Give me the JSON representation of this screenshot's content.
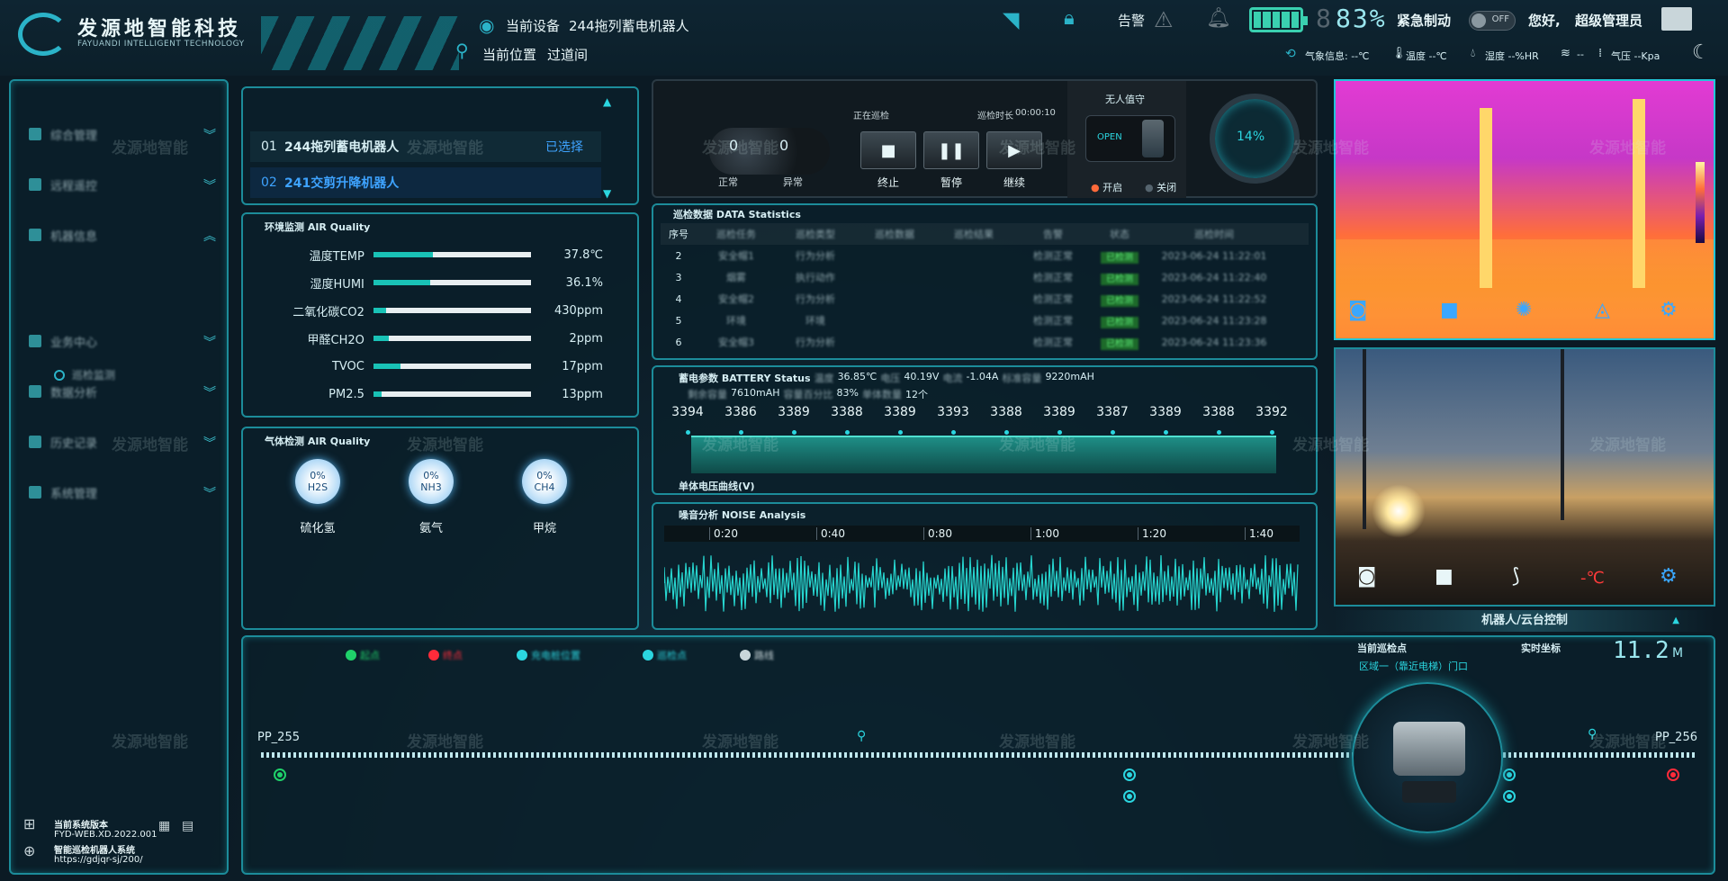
{
  "header": {
    "logo_cn": "发源地智能科技",
    "logo_en": "FAYUANDI INTELLIGENT TECHNOLOGY",
    "device_label": "当前设备",
    "device_value": "244拖列蓄电机器人",
    "location_label": "当前位置",
    "location_value": "过道间",
    "alarm_label": "告警",
    "battery_percent": "83%",
    "battery_digit": "8",
    "estop_label": "紧急制动",
    "toggle_state": "OFF",
    "greeting": "您好,",
    "user": "超级管理员",
    "weather": {
      "info": "气象信息: --℃",
      "temp": "温度 --℃",
      "humidity": "湿度 --%HR",
      "wind": "--",
      "pressure": "气压 --Kpa"
    }
  },
  "sidebar": {
    "items": [
      {
        "label": "综合管理"
      },
      {
        "label": "远程遥控"
      },
      {
        "label": "机器信息"
      },
      {
        "label": "业务中心"
      },
      {
        "label": "数据分析"
      },
      {
        "label": "历史记录"
      },
      {
        "label": "系统管理"
      }
    ],
    "sub_item": "巡检监测",
    "version_title": "当前系统版本",
    "version": "FYD-WEB.XD.2022.001",
    "system_name": "智能巡检机器人系统",
    "url": "https://gdjqr-sj/200/"
  },
  "robots": [
    {
      "no": "01",
      "name": "244拖列蓄电机器人",
      "status": "已选择"
    },
    {
      "no": "02",
      "name": "241交剪升降机器人",
      "status": ""
    }
  ],
  "env": {
    "title": "环境监测 AIR Quality",
    "rows": [
      {
        "label": "温度TEMP",
        "value": "37.8℃",
        "pct": 0.38
      },
      {
        "label": "湿度HUMI",
        "value": "36.1%",
        "pct": 0.36
      },
      {
        "label": "二氧化碳CO2",
        "value": "430ppm",
        "pct": 0.08
      },
      {
        "label": "甲醛CH2O",
        "value": "2ppm",
        "pct": 0.1
      },
      {
        "label": "TVOC",
        "value": "17ppm",
        "pct": 0.17
      },
      {
        "label": "PM2.5",
        "value": "13ppm",
        "pct": 0.05
      }
    ]
  },
  "gas": {
    "title": "气体检测 AIR Quality",
    "items": [
      {
        "pct": "0%",
        "formula": "H2S",
        "name": "硫化氢"
      },
      {
        "pct": "0%",
        "formula": "NH3",
        "name": "氨气"
      },
      {
        "pct": "0%",
        "formula": "CH4",
        "name": "甲烷"
      }
    ]
  },
  "control": {
    "normal_count": "0",
    "abnormal_count": "0",
    "normal_label": "正常",
    "abnormal_label": "异常",
    "patrolling": "正在巡检",
    "duration_label": "巡检时长",
    "duration": "00:00:10",
    "stop": "终止",
    "pause": "暂停",
    "resume": "继续",
    "unattended": "无人值守",
    "open_label": "OPEN",
    "on": "开启",
    "off": "关闭",
    "progress": "14%"
  },
  "stats": {
    "title": "巡检数据 DATA Statistics",
    "headers": [
      "序号",
      "巡检任务",
      "巡检类型",
      "巡检数据",
      "巡检结果",
      "告警",
      "状态",
      "巡检时间"
    ],
    "rows": [
      {
        "no": "2",
        "c1": "安全帽1",
        "c2": "行为分析",
        "c5": "检测正常",
        "c6": "已检测",
        "time": "2023-06-24 11:22:01"
      },
      {
        "no": "3",
        "c1": "烟雾",
        "c2": "执行动作",
        "c5": "检测正常",
        "c6": "已检测",
        "time": "2023-06-24 11:22:40"
      },
      {
        "no": "4",
        "c1": "安全帽2",
        "c2": "行为分析",
        "c5": "检测正常",
        "c6": "已检测",
        "time": "2023-06-24 11:22:52"
      },
      {
        "no": "5",
        "c1": "环境",
        "c2": "环境",
        "c5": "检测正常",
        "c6": "已检测",
        "time": "2023-06-24 11:23:28"
      },
      {
        "no": "6",
        "c1": "安全帽3",
        "c2": "行为分析",
        "c5": "检测正常",
        "c6": "已检测",
        "time": "2023-06-24 11:23:36"
      }
    ]
  },
  "battery_status": {
    "title": "蓄电参数 BATTERY Status",
    "temp_label": "温度",
    "temp": "36.85℃",
    "voltage_label": "电压",
    "voltage": "40.19V",
    "current_label": "电流",
    "current": "-1.04A",
    "std_cap_label": "标准容量",
    "std_cap": "9220mAH",
    "remain_label": "剩余容量",
    "remain": "7610mAH",
    "pct_label": "容量百分比",
    "pct": "83%",
    "count_label": "单体数量",
    "count": "12个",
    "cells": [
      "3394",
      "3386",
      "3389",
      "3388",
      "3389",
      "3393",
      "3388",
      "3389",
      "3387",
      "3389",
      "3388",
      "3392"
    ],
    "curve_label": "单体电压曲线(V)"
  },
  "noise": {
    "title": "噪音分析 NOISE Analysis",
    "ticks": [
      "0:20",
      "0:40",
      "0:80",
      "1:00",
      "1:20",
      "1:40"
    ]
  },
  "camera": {
    "control_label": "机器人/云台控制",
    "temp_mark": "-℃"
  },
  "bottom": {
    "legend": [
      {
        "label": "起点",
        "color": "#1fd16a"
      },
      {
        "label": "终点",
        "color": "#ff2b3a"
      },
      {
        "label": "充电桩位置",
        "color": "#2bd6e0"
      },
      {
        "label": "巡检点",
        "color": "#2bd6e0"
      },
      {
        "label": "路线",
        "color": "#c9d6da"
      }
    ],
    "left_point": "PP_255",
    "right_point": "PP_256",
    "current_label": "当前巡检点",
    "current_value": "区域一（靠近电梯）门口",
    "coord_label": "实时坐标",
    "coord_value": "11.2",
    "coord_unit": "M"
  },
  "watermark": "发源地智能",
  "colors": {
    "accent": "#1c8c9a",
    "cyan": "#2bd6e0",
    "green": "#1fd16a",
    "red": "#ff2b3a"
  }
}
